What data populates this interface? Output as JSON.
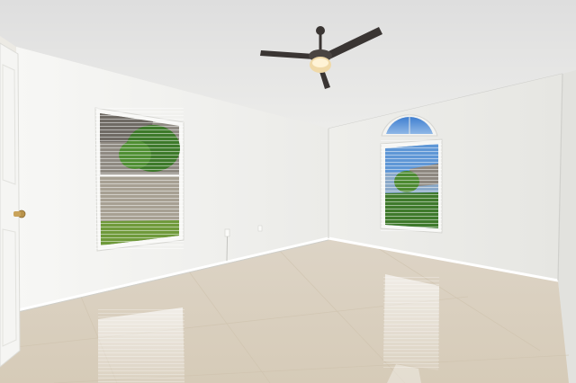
{
  "scene": {
    "subject": "empty-bedroom-interior",
    "colors": {
      "ceiling": "#e6e6e2",
      "wall_left": "#f2f2ef",
      "wall_back": "#eeeeeb",
      "wall_right": "#e4e4e0",
      "floor": "#ddd3c3",
      "fan": "#3a3533",
      "fan_light": "#f0d9a8",
      "sky": "#4d8ed6",
      "grass": "#6f9a3a",
      "door": "#f4f4f2",
      "knob": "#b8924a"
    }
  }
}
